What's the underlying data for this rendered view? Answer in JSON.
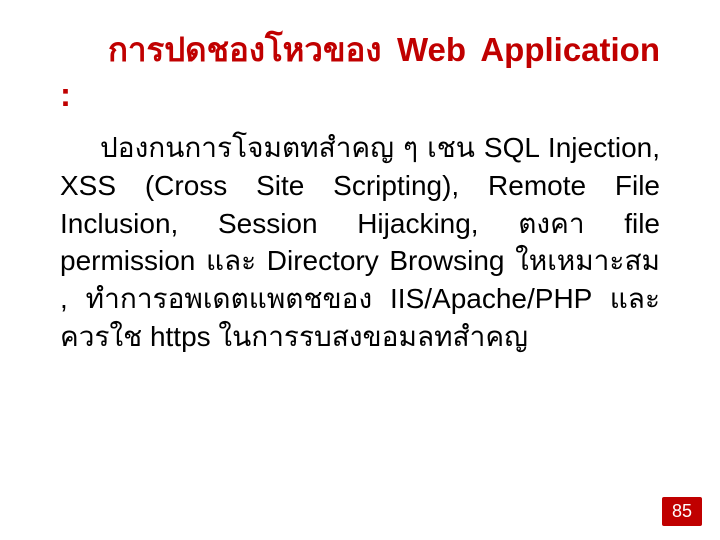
{
  "title": {
    "line": "การปดชองโหวของ Web Application :"
  },
  "body": {
    "text": "ปองกนการโจมตทสำคญ ๆ เชน SQL Injection, XSS (Cross Site Scripting), Remote File Inclusion, Session Hijacking, ตงคา file permission และ Directory Browsing ใหเหมาะสม , ทำการอพเดตแพตชของ IIS/Apache/PHP และควรใช https ในการรบสงขอมลทสำคญ"
  },
  "page_number": "85"
}
